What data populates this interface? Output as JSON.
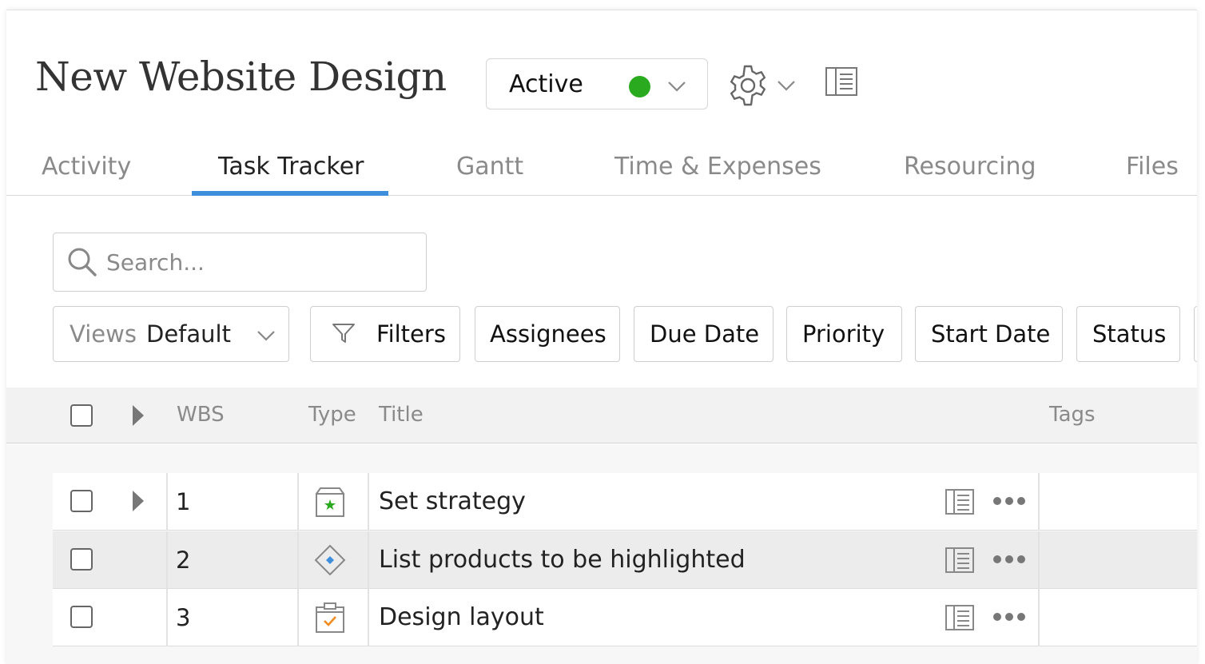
{
  "header": {
    "title": "New Website Design",
    "status": {
      "label": "Active",
      "color": "#2aaa1f",
      "icon": "chevron-down-icon"
    },
    "settings_icon": "gear-icon",
    "panel_icon": "details-panel-icon"
  },
  "tabs": [
    {
      "label": "Activity",
      "active": false
    },
    {
      "label": "Task Tracker",
      "active": true
    },
    {
      "label": "Gantt",
      "active": false
    },
    {
      "label": "Time & Expenses",
      "active": false
    },
    {
      "label": "Resourcing",
      "active": false
    },
    {
      "label": "Files",
      "active": false
    }
  ],
  "accent_color": "#3d8fdc",
  "search": {
    "placeholder": "Search...",
    "value": ""
  },
  "toolbar": {
    "views_label": "Views",
    "views_value": "Default",
    "filters_label": "Filters",
    "filter_buttons": [
      "Assignees",
      "Due Date",
      "Priority",
      "Start Date",
      "Status"
    ]
  },
  "table": {
    "columns": {
      "wbs": "WBS",
      "type": "Type",
      "title": "Title",
      "tags": "Tags"
    },
    "rows": [
      {
        "wbs": "1",
        "title": "Set strategy",
        "type_icon": "group-star-icon",
        "expandable": true,
        "highlighted": false
      },
      {
        "wbs": "2",
        "title": "List products to be highlighted",
        "type_icon": "milestone-diamond-icon",
        "expandable": false,
        "highlighted": true
      },
      {
        "wbs": "3",
        "title": "Design layout",
        "type_icon": "task-checkmark-icon",
        "expandable": false,
        "highlighted": false
      }
    ]
  }
}
